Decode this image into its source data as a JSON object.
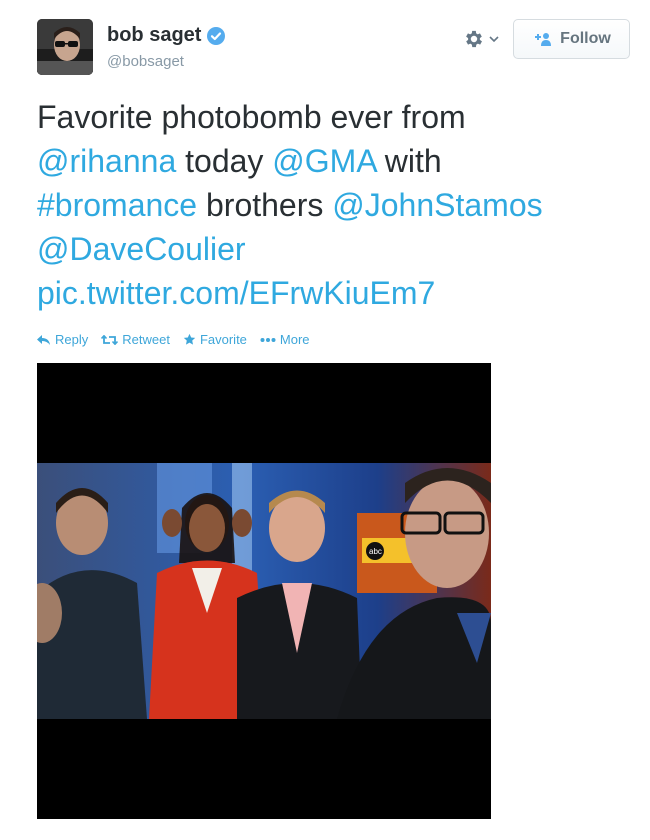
{
  "user": {
    "name": "bob saget",
    "handle": "@bobsaget"
  },
  "follow_label": "Follow",
  "tweet": {
    "line1": [
      "Favorite photobomb ever from"
    ],
    "line2": [
      "@rihanna",
      " today ",
      "@GMA",
      " with"
    ],
    "line3": [
      "#bromance",
      " brothers ",
      "@JohnStamos"
    ],
    "line4": [
      "@DaveCoulier"
    ],
    "line5": [
      "pic.twitter.com/EFrwKiuEm7"
    ]
  },
  "actions": {
    "reply": "Reply",
    "retweet": "Retweet",
    "favorite": "Favorite",
    "more": "More"
  },
  "colors": {
    "link": "#2fa9e0",
    "text": "#292f33",
    "handle": "#8899a6",
    "verified": "#55acee"
  },
  "icons": [
    "verified-badge-icon",
    "gear-icon",
    "chevron-down-icon",
    "add-user-icon",
    "reply-icon",
    "retweet-icon",
    "star-icon",
    "ellipsis-icon"
  ],
  "photo": {
    "logo": "abc"
  }
}
